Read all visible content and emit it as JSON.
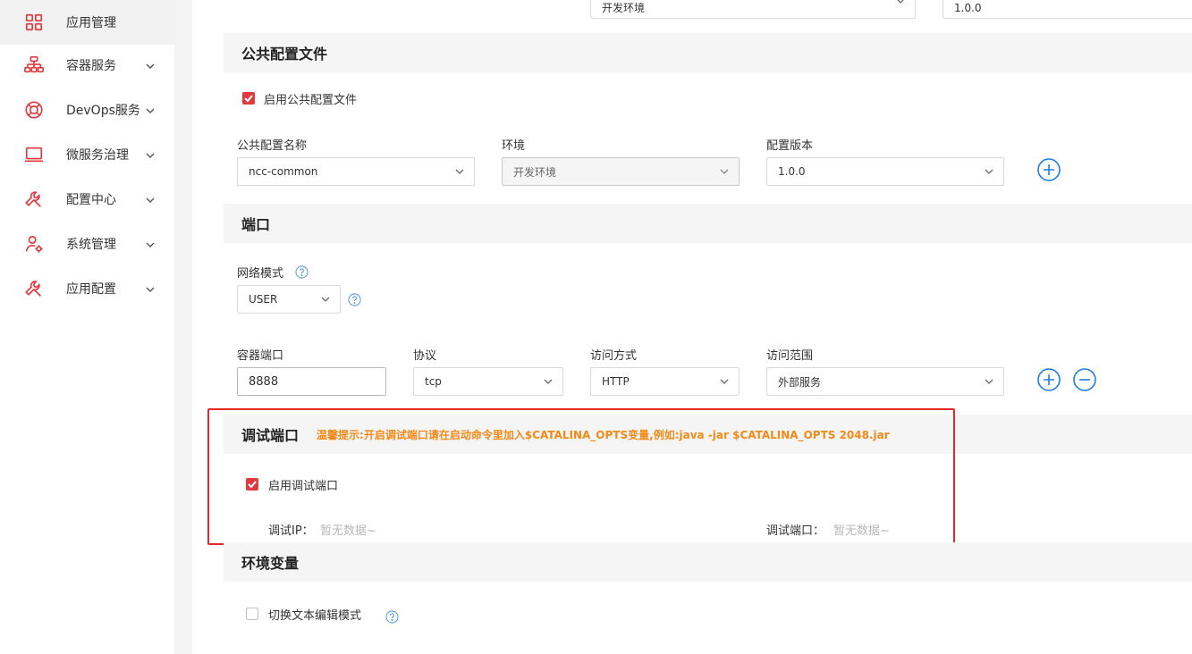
{
  "sidebar": {
    "items": [
      {
        "label": "应用管理",
        "icon": "grid-icon",
        "active": true
      },
      {
        "label": "容器服务",
        "icon": "sitemap-icon"
      },
      {
        "label": "DevOps服务",
        "icon": "lifebuoy-icon"
      },
      {
        "label": "微服务治理",
        "icon": "laptop-icon"
      },
      {
        "label": "配置中心",
        "icon": "wrench-icon"
      },
      {
        "label": "系统管理",
        "icon": "user-gear-icon"
      },
      {
        "label": "应用配置",
        "icon": "wrench-icon"
      }
    ]
  },
  "top_row": {
    "env_value": "开发环境",
    "version_value": "1.0.0"
  },
  "public_config": {
    "title": "公共配置文件",
    "enable_label": "启用公共配置文件",
    "enabled": true,
    "name_label": "公共配置名称",
    "name_value": "ncc-common",
    "env_label": "环境",
    "env_value": "开发环境",
    "version_label": "配置版本",
    "version_value": "1.0.0"
  },
  "port": {
    "title": "端口",
    "network_mode_label": "网络模式",
    "network_mode_value": "USER",
    "container_port_label": "容器端口",
    "container_port_value": "8888",
    "protocol_label": "协议",
    "protocol_value": "tcp",
    "access_method_label": "访问方式",
    "access_method_value": "HTTP",
    "access_scope_label": "访问范围",
    "access_scope_value": "外部服务"
  },
  "debug_port": {
    "title": "调试端口",
    "warning": "温馨提示:开启调试端口请在启动命令里加入$CATALINA_OPTS变量,例如:java -jar $CATALINA_OPTS 2048.jar",
    "enable_label": "启用调试端口",
    "enabled": true,
    "ip_label": "调试IP：",
    "ip_value": "暂无数据~",
    "port_label": "调试端口：",
    "port_value": "暂无数据~"
  },
  "env_vars": {
    "title": "环境变量",
    "toggle_label": "切换文本编辑模式",
    "toggle_checked": false
  },
  "colors": {
    "accent": "#e0393e",
    "link_blue": "#1e7ee6",
    "warning": "#f28a1a",
    "highlight_border": "#e02a2a"
  }
}
